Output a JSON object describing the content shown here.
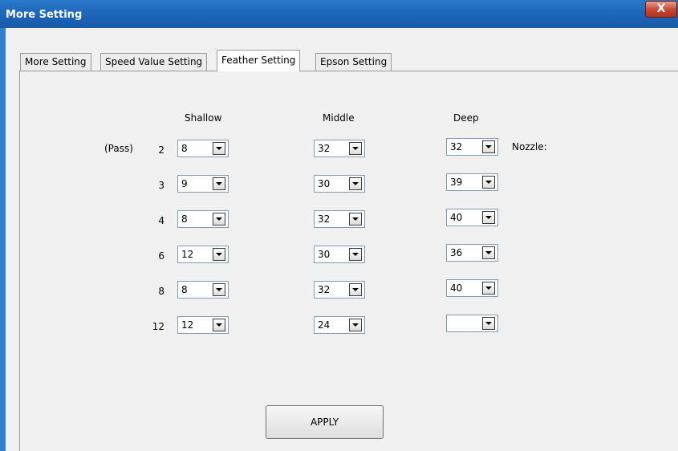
{
  "window": {
    "title": "More Setting",
    "close_label": "X"
  },
  "tabs": [
    {
      "label": "More Setting",
      "active": false
    },
    {
      "label": "Speed Value Setting",
      "active": false
    },
    {
      "label": "Feather Setting",
      "active": true
    },
    {
      "label": "Epson Setting",
      "active": false
    }
  ],
  "columns": {
    "shallow": "Shallow",
    "middle": "Middle",
    "deep": "Deep"
  },
  "pass_label": "(Pass)",
  "nozzle_label": "Nozzle:",
  "rows": [
    {
      "pass": "2",
      "shallow": "8",
      "middle": "32",
      "deep": "32"
    },
    {
      "pass": "3",
      "shallow": "9",
      "middle": "30",
      "deep": "39"
    },
    {
      "pass": "4",
      "shallow": "8",
      "middle": "32",
      "deep": "40"
    },
    {
      "pass": "6",
      "shallow": "12",
      "middle": "30",
      "deep": "36"
    },
    {
      "pass": "8",
      "shallow": "8",
      "middle": "32",
      "deep": "40"
    },
    {
      "pass": "12",
      "shallow": "12",
      "middle": "24",
      "deep": ""
    }
  ],
  "apply_label": "APPLY",
  "colors": {
    "titlebar": "#1c64b8",
    "close_button": "#c84b35",
    "background": "#f0f0f0"
  }
}
